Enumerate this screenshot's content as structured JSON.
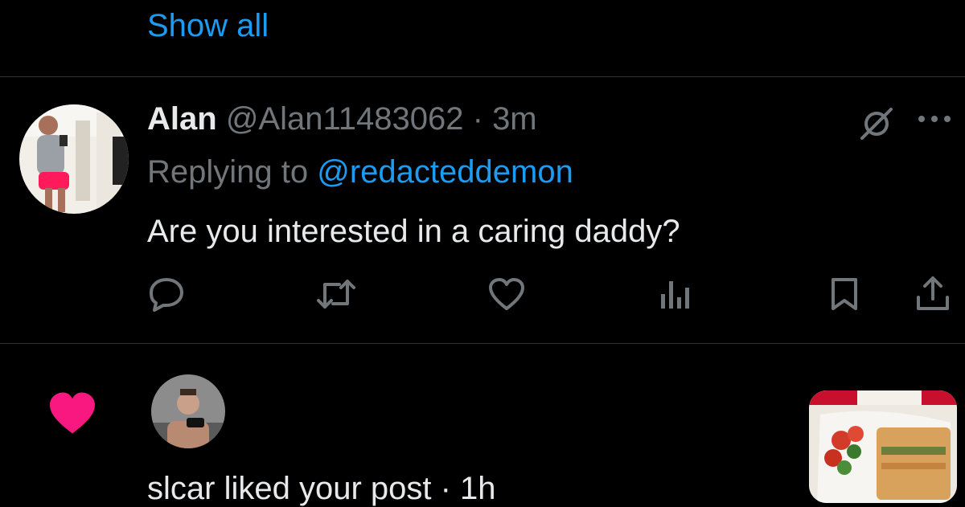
{
  "thread": {
    "show_all_label": "Show all"
  },
  "tweet": {
    "author_name": "Alan",
    "author_handle": "@Alan11483062",
    "separator": "·",
    "time_ago": "3m",
    "replying_prefix": "Replying to",
    "replying_handle": "@redacteddemon",
    "text": "Are you interested in a caring daddy?",
    "actions": [
      "reply-icon",
      "retweet-icon",
      "like-icon",
      "views-icon",
      "bookmark-icon",
      "share-icon"
    ]
  },
  "notification": {
    "icon": "heart-icon",
    "icon_color": "#f91880",
    "text": "slcar liked your post · 1h"
  },
  "colors": {
    "accent": "#1d9bf0",
    "muted": "#71767b",
    "text": "#e7e9ea",
    "background": "#000000"
  }
}
